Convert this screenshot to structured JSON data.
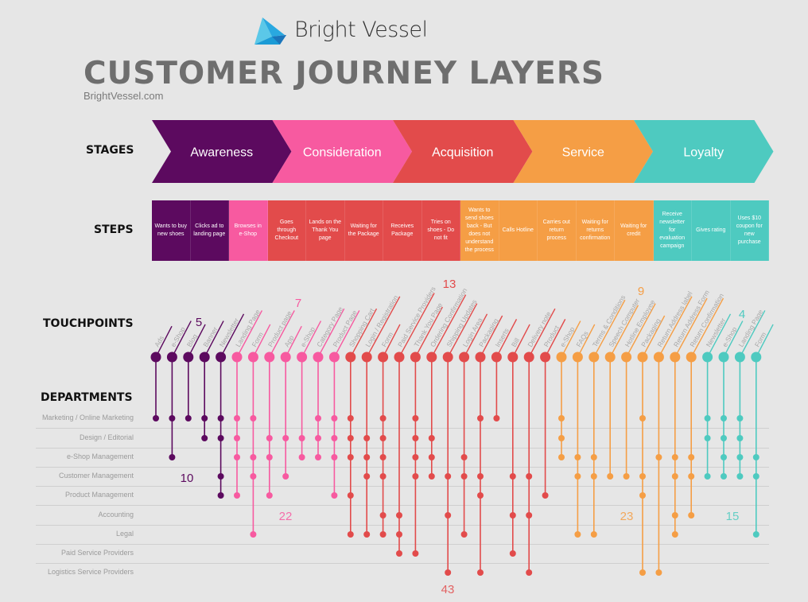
{
  "brand": {
    "name": "Bright Vessel",
    "logo_icon": "paper-boat-icon",
    "colors": [
      "#29a8e0",
      "#5bc8e8",
      "#1b75bb"
    ]
  },
  "header": {
    "title": "CUSTOMER JOURNEY LAYERS",
    "subtitle": "BrightVessel.com"
  },
  "row_labels": {
    "stages": "STAGES",
    "steps": "STEPS",
    "touchpoints": "TOUCHPOINTS",
    "departments": "DEPARTMENTS"
  },
  "stages": [
    {
      "label": "Awareness",
      "color": "#5c0a5f"
    },
    {
      "label": "Consideration",
      "color": "#f75aa0"
    },
    {
      "label": "Acquisition",
      "color": "#e24b4b"
    },
    {
      "label": "Service",
      "color": "#f59e45"
    },
    {
      "label": "Loyalty",
      "color": "#4ecac0"
    }
  ],
  "steps": [
    {
      "label": "Wants to buy new shoes",
      "stage": 0
    },
    {
      "label": "Clicks ad to landing page",
      "stage": 0
    },
    {
      "label": "Browses in e-Shop",
      "stage": 1
    },
    {
      "label": "Goes through Checkout",
      "stage": 2
    },
    {
      "label": "Lands on the Thank You page",
      "stage": 2
    },
    {
      "label": "Waiting for the Package",
      "stage": 2
    },
    {
      "label": "Receives Package",
      "stage": 2
    },
    {
      "label": "Tries on shoes - Do not fit",
      "stage": 2
    },
    {
      "label": "Wants to send shoes back - But does not understand the process",
      "stage": 3
    },
    {
      "label": "Calls Hotline",
      "stage": 3
    },
    {
      "label": "Carries out return process",
      "stage": 3
    },
    {
      "label": "Waiting for returns confirmation",
      "stage": 3
    },
    {
      "label": "Waiting for credit",
      "stage": 3
    },
    {
      "label": "Receive newsletter for evaluation campaign",
      "stage": 4
    },
    {
      "label": "Gives rating",
      "stage": 4
    },
    {
      "label": "Uses $10 coupon for new purchase",
      "stage": 4
    }
  ],
  "departments": [
    "Marketing / Online Marketing",
    "Design / Editorial",
    "e-Shop Management",
    "Customer Management",
    "Product Management",
    "Accounting",
    "Legal",
    "Paid Service Providers",
    "Logistics Service Providers"
  ],
  "chart_data": {
    "type": "matrix",
    "title": "Customer Journey Layers",
    "stage_touchpoint_counts": [
      5,
      7,
      13,
      9,
      4
    ],
    "stage_department_link_totals": [
      10,
      22,
      43,
      23,
      15
    ],
    "touchpoints": [
      {
        "label": "Ads",
        "stage": 0,
        "departments": [
          0
        ]
      },
      {
        "label": "e-Shop",
        "stage": 0,
        "departments": [
          0,
          2
        ]
      },
      {
        "label": "Blog",
        "stage": 0,
        "departments": [
          0
        ]
      },
      {
        "label": "Banner",
        "stage": 0,
        "departments": [
          0,
          1
        ]
      },
      {
        "label": "Newsletter",
        "stage": 0,
        "departments": [
          0,
          1,
          3,
          4
        ]
      },
      {
        "label": "Landing Page",
        "stage": 1,
        "departments": [
          0,
          1,
          2,
          4
        ]
      },
      {
        "label": "Form",
        "stage": 1,
        "departments": [
          0,
          2,
          3,
          6
        ]
      },
      {
        "label": "Product page",
        "stage": 1,
        "departments": [
          1,
          2,
          4
        ]
      },
      {
        "label": "App",
        "stage": 1,
        "departments": [
          1,
          3
        ]
      },
      {
        "label": "e-Shop",
        "stage": 1,
        "departments": [
          1,
          2
        ]
      },
      {
        "label": "Category Page",
        "stage": 1,
        "departments": [
          0,
          1,
          2
        ]
      },
      {
        "label": "Product Page",
        "stage": 1,
        "departments": [
          0,
          1,
          2,
          4
        ]
      },
      {
        "label": "Shopping Cart",
        "stage": 2,
        "departments": [
          0,
          1,
          2,
          4,
          6
        ]
      },
      {
        "label": "Login / Registration",
        "stage": 2,
        "departments": [
          1,
          2,
          3,
          6
        ]
      },
      {
        "label": "Form",
        "stage": 2,
        "departments": [
          0,
          1,
          2,
          3,
          5,
          6
        ]
      },
      {
        "label": "Paid Service Providers",
        "stage": 2,
        "departments": [
          5,
          6,
          7
        ]
      },
      {
        "label": "Thank You Page",
        "stage": 2,
        "departments": [
          0,
          1,
          2,
          3,
          7
        ]
      },
      {
        "label": "Ordering Confirmation",
        "stage": 2,
        "departments": [
          1,
          2,
          3
        ]
      },
      {
        "label": "Shipping Updates",
        "stage": 2,
        "departments": [
          3,
          5,
          8
        ]
      },
      {
        "label": "Login Area",
        "stage": 2,
        "departments": [
          2,
          3,
          6
        ]
      },
      {
        "label": "Packaging",
        "stage": 2,
        "departments": [
          0,
          3,
          4,
          8
        ]
      },
      {
        "label": "Inserts",
        "stage": 2,
        "departments": [
          0
        ]
      },
      {
        "label": "Bill",
        "stage": 2,
        "departments": [
          3,
          5,
          7
        ]
      },
      {
        "label": "Delivery note",
        "stage": 2,
        "departments": [
          3,
          5,
          8
        ]
      },
      {
        "label": "Product",
        "stage": 2,
        "departments": [
          4
        ]
      },
      {
        "label": "e-Shop",
        "stage": 3,
        "departments": [
          0,
          1,
          2
        ]
      },
      {
        "label": "FAQs",
        "stage": 3,
        "departments": [
          2,
          3,
          6
        ]
      },
      {
        "label": "Terms & Conditions",
        "stage": 3,
        "departments": [
          2,
          3,
          6
        ]
      },
      {
        "label": "Speech Computer",
        "stage": 3,
        "departments": [
          3
        ]
      },
      {
        "label": "Hotline Employee",
        "stage": 3,
        "departments": [
          3
        ]
      },
      {
        "label": "Packaging",
        "stage": 3,
        "departments": [
          0,
          3,
          4,
          8
        ]
      },
      {
        "label": "Return Address label",
        "stage": 3,
        "departments": [
          2,
          8
        ]
      },
      {
        "label": "Return Address Form",
        "stage": 3,
        "departments": [
          2,
          3,
          5,
          6
        ]
      },
      {
        "label": "Return Confirmation",
        "stage": 3,
        "departments": [
          2,
          3,
          5
        ]
      },
      {
        "label": "Newsletter",
        "stage": 4,
        "departments": [
          0,
          1,
          3
        ]
      },
      {
        "label": "e-Shop",
        "stage": 4,
        "departments": [
          0,
          1,
          2,
          3
        ]
      },
      {
        "label": "Landing Page",
        "stage": 4,
        "departments": [
          0,
          1,
          2,
          3
        ]
      },
      {
        "label": "Form",
        "stage": 4,
        "departments": [
          2,
          3,
          6
        ]
      }
    ]
  }
}
